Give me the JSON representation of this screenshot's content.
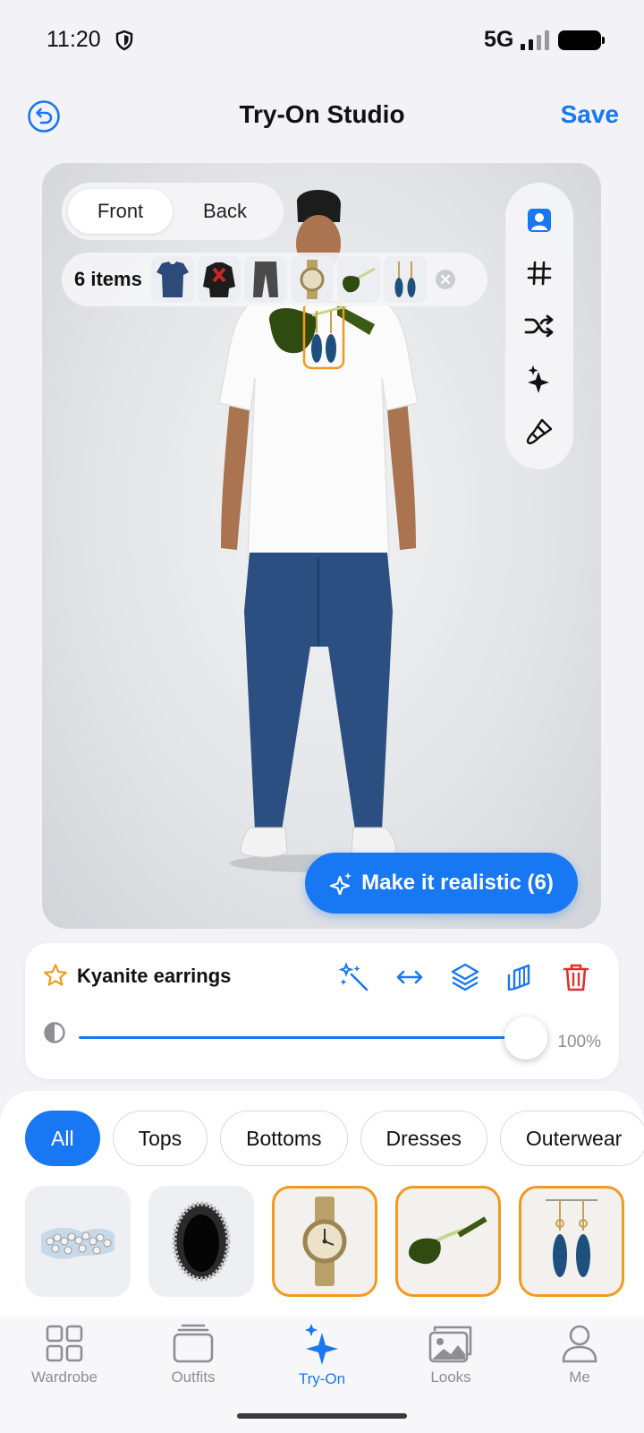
{
  "status_bar": {
    "time": "11:20",
    "network": "5G"
  },
  "header": {
    "title": "Try-On Studio",
    "save_label": "Save"
  },
  "canvas": {
    "view_options": [
      "Front",
      "Back"
    ],
    "active_view": "Front",
    "items_count_label": "6 items",
    "items": [
      "t-shirt",
      "jacket",
      "jeans",
      "watch",
      "sunglasses",
      "earrings"
    ],
    "tools": [
      "person-icon",
      "grid-icon",
      "shuffle-icon",
      "sparkle-icon",
      "brush-icon"
    ],
    "realistic_button_label": "Make it realistic (6)"
  },
  "selected_item": {
    "name": "Kyanite earrings",
    "actions": [
      "magic-wand-icon",
      "flip-icon",
      "layers-icon",
      "duplicate-icon",
      "trash-icon"
    ],
    "opacity": 100,
    "opacity_label": "100%"
  },
  "categories": {
    "chips": [
      "All",
      "Tops",
      "Bottoms",
      "Dresses",
      "Outerwear"
    ],
    "active": "All"
  },
  "wardrobe_items": [
    {
      "type": "pearl-necklace",
      "selected": false
    },
    {
      "type": "lace-collar",
      "selected": false
    },
    {
      "type": "watch",
      "selected": true
    },
    {
      "type": "sunglasses",
      "selected": true
    },
    {
      "type": "earrings",
      "selected": true
    }
  ],
  "tabbar": {
    "tabs": [
      {
        "label": "Wardrobe",
        "icon": "grid-icon"
      },
      {
        "label": "Outfits",
        "icon": "stack-icon"
      },
      {
        "label": "Try-On",
        "icon": "sparkle-icon"
      },
      {
        "label": "Looks",
        "icon": "photos-icon"
      },
      {
        "label": "Me",
        "icon": "person-icon"
      }
    ],
    "active": "Try-On"
  },
  "colors": {
    "accent": "#1877f2",
    "selected_border": "#f29a1f",
    "danger": "#e03131"
  }
}
